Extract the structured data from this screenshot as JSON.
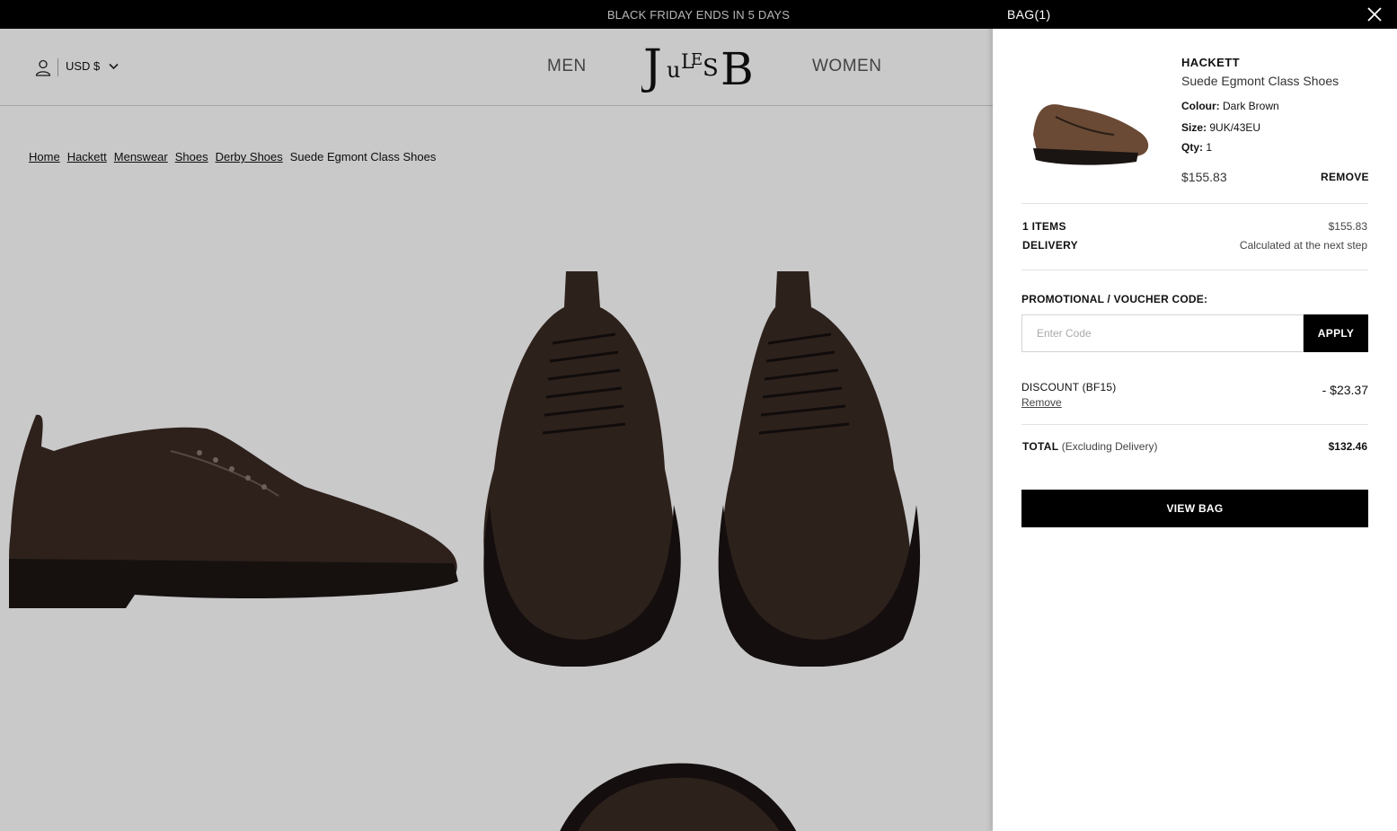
{
  "announcement": "BLACK FRIDAY ENDS IN 5 DAYS",
  "header": {
    "currency": "USD $",
    "nav_men": "MEN",
    "nav_women": "WOMEN",
    "logo_text": "JulesB"
  },
  "breadcrumb": {
    "items": [
      "Home",
      "Hackett",
      "Menswear",
      "Shoes",
      "Derby Shoes"
    ],
    "current": "Suede Egmont Class Shoes"
  },
  "bag": {
    "title": "BAG(1)",
    "item": {
      "brand": "HACKETT",
      "name": "Suede Egmont Class Shoes",
      "colour_label": "Colour:",
      "colour": "Dark Brown",
      "size_label": "Size:",
      "size": "9UK/43EU",
      "qty_label": "Qty:",
      "qty": "1",
      "price": "$155.83",
      "remove": "REMOVE"
    },
    "summary": {
      "items_label": "1 ITEMS",
      "items_value": "$155.83",
      "delivery_label": "DELIVERY",
      "delivery_value": "Calculated at the next step"
    },
    "promo": {
      "label": "PROMOTIONAL / VOUCHER CODE:",
      "placeholder": "Enter Code",
      "apply": "APPLY"
    },
    "discount": {
      "label": "DISCOUNT (BF15)",
      "remove": "Remove",
      "value": "- $23.37"
    },
    "total": {
      "label": "TOTAL",
      "sublabel": "(Excluding Delivery)",
      "value": "$132.46"
    },
    "view_bag": "VIEW BAG"
  },
  "icons": {
    "account": "user-icon",
    "currency_dropdown": "chevron-down-icon",
    "close": "close-icon"
  },
  "colors": {
    "announcement_bg": "#000000",
    "button_bg": "#000000",
    "overlay": "rgba(0,0,0,0.21)"
  }
}
